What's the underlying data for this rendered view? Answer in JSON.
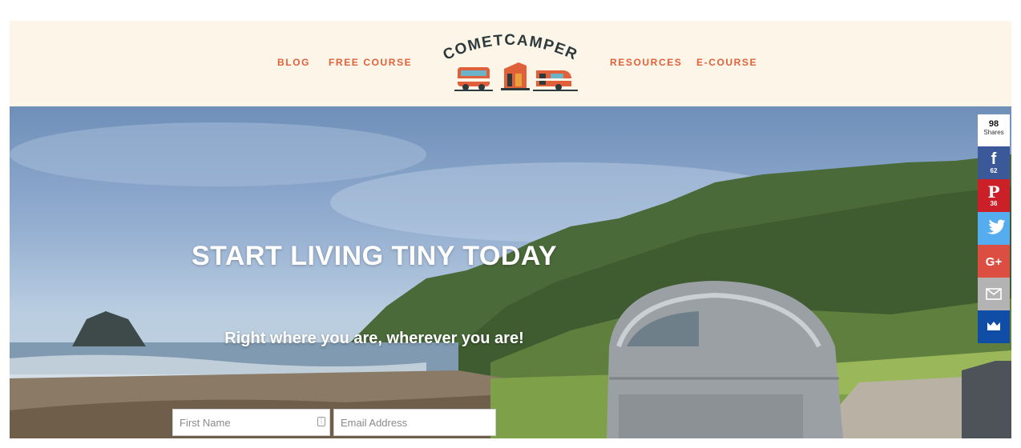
{
  "nav": {
    "left": [
      "BLOG",
      "FREE COURSE"
    ],
    "right": [
      "RESOURCES",
      "E-COURSE"
    ]
  },
  "logo": {
    "text": "COMETCAMPER",
    "accent": "#e0603a",
    "dark": "#2c3a3c"
  },
  "hero": {
    "title": "START LIVING TINY TODAY",
    "subtitle": "Right where you are, wherever you are!"
  },
  "form": {
    "first_name_placeholder": "First Name",
    "email_placeholder": "Email Address"
  },
  "share": {
    "total": "98",
    "total_label": "Shares",
    "buttons": [
      {
        "name": "facebook",
        "icon": "facebook-icon",
        "count": "62",
        "color": "#3b5998"
      },
      {
        "name": "pinterest",
        "icon": "pinterest-icon",
        "count": "36",
        "color": "#cb2027"
      },
      {
        "name": "twitter",
        "icon": "twitter-icon",
        "count": "",
        "color": "#55acee"
      },
      {
        "name": "google-plus",
        "icon": "google-plus-icon",
        "count": "",
        "color": "#dc4e41"
      },
      {
        "name": "email",
        "icon": "email-icon",
        "count": "",
        "color": "#b3b3b3"
      },
      {
        "name": "sumo",
        "icon": "crown-icon",
        "count": "",
        "color": "#0f4da6"
      }
    ]
  },
  "colors": {
    "header_bg": "#fdf5e8",
    "nav_link": "#e0603a"
  }
}
